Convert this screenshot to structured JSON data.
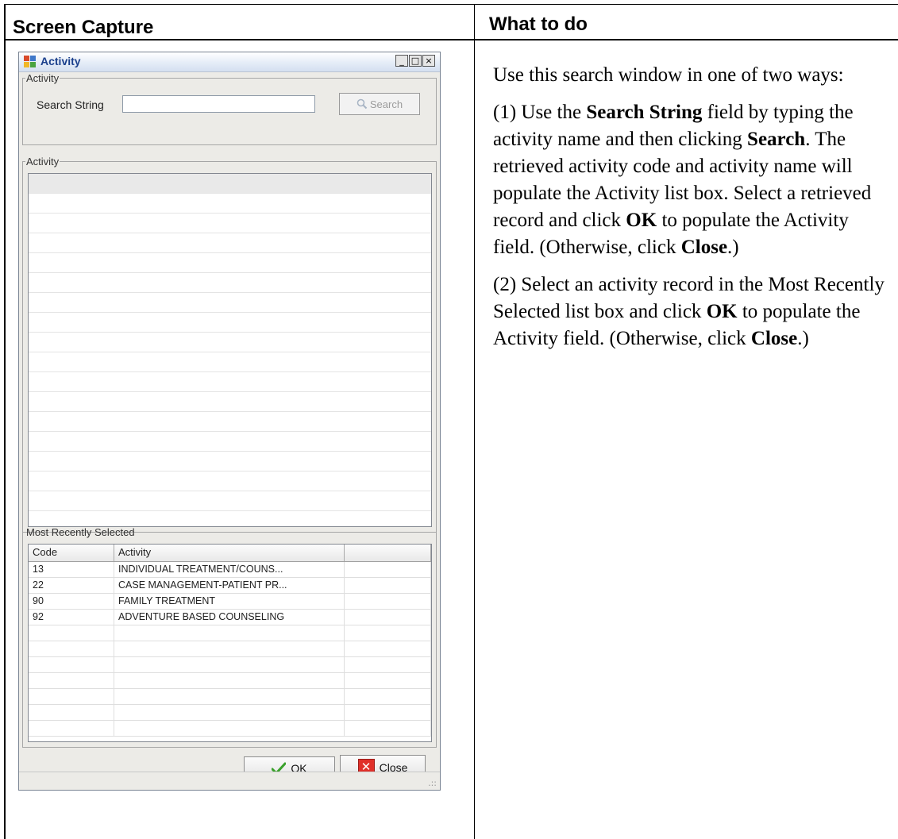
{
  "table": {
    "left_header": "Screen Capture",
    "right_header": "What to do"
  },
  "instructions": {
    "p1": "Use this search window in one of two ways:",
    "p2_pre": "(1) Use the ",
    "p2_b1": "Search String",
    "p2_mid1": " field by typing the activity name and then clicking ",
    "p2_b2": "Search",
    "p2_mid2": ". The retrieved activity code and activity name will populate the Activity list box. Select a retrieved record and click ",
    "p2_b3": "OK",
    "p2_mid3": " to populate the Activity field. (Otherwise, click ",
    "p2_b4": "Close",
    "p2_end": ".)",
    "p3_pre": "(2) Select an activity record in the Most Recently Selected list box and click ",
    "p3_b1": "OK",
    "p3_mid": " to populate the Activity field. (Otherwise, click ",
    "p3_b2": "Close",
    "p3_end": ".)"
  },
  "dialog": {
    "title": "Activity",
    "window_buttons": {
      "minimize": "_",
      "maximize": "□",
      "close": "×"
    },
    "search_group_label": "Activity",
    "search_label": "Search String",
    "search_value": "",
    "search_button": "Search",
    "results_group_label": "Activity",
    "recent_group_label": "Most Recently Selected",
    "recent_columns": [
      "Code",
      "Activity",
      ""
    ],
    "recent_rows": [
      {
        "code": "13",
        "activity": "INDIVIDUAL TREATMENT/COUNS..."
      },
      {
        "code": "22",
        "activity": "CASE MANAGEMENT-PATIENT PR..."
      },
      {
        "code": "90",
        "activity": "FAMILY TREATMENT"
      },
      {
        "code": "92",
        "activity": "ADVENTURE BASED COUNSELING"
      }
    ],
    "ok_button": "OK",
    "close_button": "Close",
    "grip": ".::"
  },
  "colors": {
    "dialog_bg": "#ecebe7",
    "title_text": "#1a3f8c",
    "ok_check": "#3aa12b",
    "close_red": "#e0302a"
  },
  "icons": {
    "app": "activity-app-icon",
    "search": "magnifier-icon",
    "ok": "green-check-icon",
    "close": "red-x-icon"
  }
}
